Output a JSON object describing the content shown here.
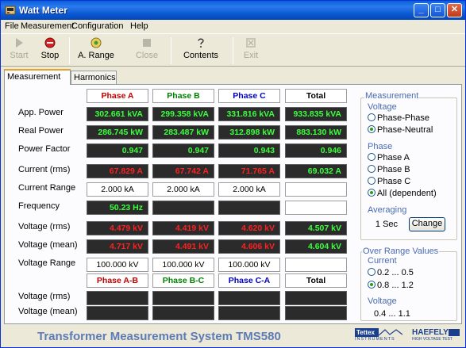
{
  "window": {
    "title": "Watt Meter"
  },
  "menu": [
    "File",
    "Measurement",
    "Configuration",
    "Help"
  ],
  "toolbar": [
    {
      "label": "Start",
      "icon": "play-icon",
      "enabled": false
    },
    {
      "label": "Stop",
      "icon": "stop-icon",
      "enabled": true
    },
    {
      "label": "A. Range",
      "icon": "auto-range-icon",
      "enabled": true
    },
    {
      "label": "Close",
      "icon": "close-doc-icon",
      "enabled": false
    },
    {
      "label": "Contents",
      "icon": "help-contents-icon",
      "enabled": true
    },
    {
      "label": "Exit",
      "icon": "exit-icon",
      "enabled": false
    }
  ],
  "tabs": [
    "Measurement",
    "Harmonics"
  ],
  "table1": {
    "headers": [
      "Phase A",
      "Phase B",
      "Phase C",
      "Total"
    ],
    "rows": [
      {
        "label": "App. Power",
        "values": [
          "302.661 kVA",
          "299.358 kVA",
          "331.816 kVA",
          "933.835 kVA"
        ]
      },
      {
        "label": "Real Power",
        "values": [
          "286.745 kW",
          "283.487 kW",
          "312.898 kW",
          "883.130 kW"
        ]
      },
      {
        "label": "Power Factor",
        "values": [
          "0.947",
          "0.947",
          "0.943",
          "0.946"
        ]
      },
      {
        "label": "Current (rms)",
        "values": [
          "67.829 A",
          "67.742 A",
          "71.765 A",
          "69.032 A"
        ]
      },
      {
        "label": "Current Range",
        "values": [
          "2.000 kA",
          "2.000 kA",
          "2.000 kA",
          ""
        ]
      },
      {
        "label": "Frequency",
        "values": [
          "50.23 Hz",
          "",
          "",
          ""
        ]
      },
      {
        "label": "Voltage (rms)",
        "values": [
          "4.479 kV",
          "4.419 kV",
          "4.620 kV",
          "4.507 kV"
        ]
      },
      {
        "label": "Voltage (mean)",
        "values": [
          "4.717 kV",
          "4.491 kV",
          "4.606 kV",
          "4.604 kV"
        ]
      },
      {
        "label": "Voltage Range",
        "values": [
          "100.000 kV",
          "100.000 kV",
          "100.000 kV",
          ""
        ]
      }
    ]
  },
  "table2": {
    "headers": [
      "Phase A-B",
      "Phase B-C",
      "Phase C-A",
      "Total"
    ],
    "rows": [
      {
        "label": "Voltage (rms)",
        "values": [
          "",
          "",
          "",
          ""
        ]
      },
      {
        "label": "Voltage (mean)",
        "values": [
          "",
          "",
          "",
          ""
        ]
      }
    ]
  },
  "side": {
    "measurement_legend": "Measurement",
    "voltage_label": "Voltage",
    "voltage_options": [
      {
        "label": "Phase-Phase",
        "selected": false
      },
      {
        "label": "Phase-Neutral",
        "selected": true
      }
    ],
    "phase_label": "Phase",
    "phase_options": [
      {
        "label": "Phase A",
        "selected": false
      },
      {
        "label": "Phase B",
        "selected": false
      },
      {
        "label": "Phase C",
        "selected": false
      },
      {
        "label": "All (dependent)",
        "selected": true
      }
    ],
    "averaging_label": "Averaging",
    "averaging_value": "1 Sec",
    "change_button": "Change",
    "overrange_legend": "Over Range Values",
    "current_label": "Current",
    "current_options": [
      {
        "label": "0.2 ... 0.5",
        "selected": false
      },
      {
        "label": "0.8 ... 1.2",
        "selected": true
      }
    ],
    "or_voltage_label": "Voltage",
    "or_voltage_value": "0.4 ... 1.1"
  },
  "footer": {
    "title": "Transformer Measurement System TMS580",
    "logo1": "Tettex",
    "logo1_sub": "INSTRUMENTS",
    "logo2": "HAEFELY",
    "logo2_sub": "HIGH VOLTAGE TEST"
  },
  "colors": {
    "header_a": "#c00000",
    "header_b": "#008000",
    "header_c": "#0000c0",
    "header_total": "#000000",
    "value_green": "#3cff3c",
    "value_red": "#ff2020"
  }
}
